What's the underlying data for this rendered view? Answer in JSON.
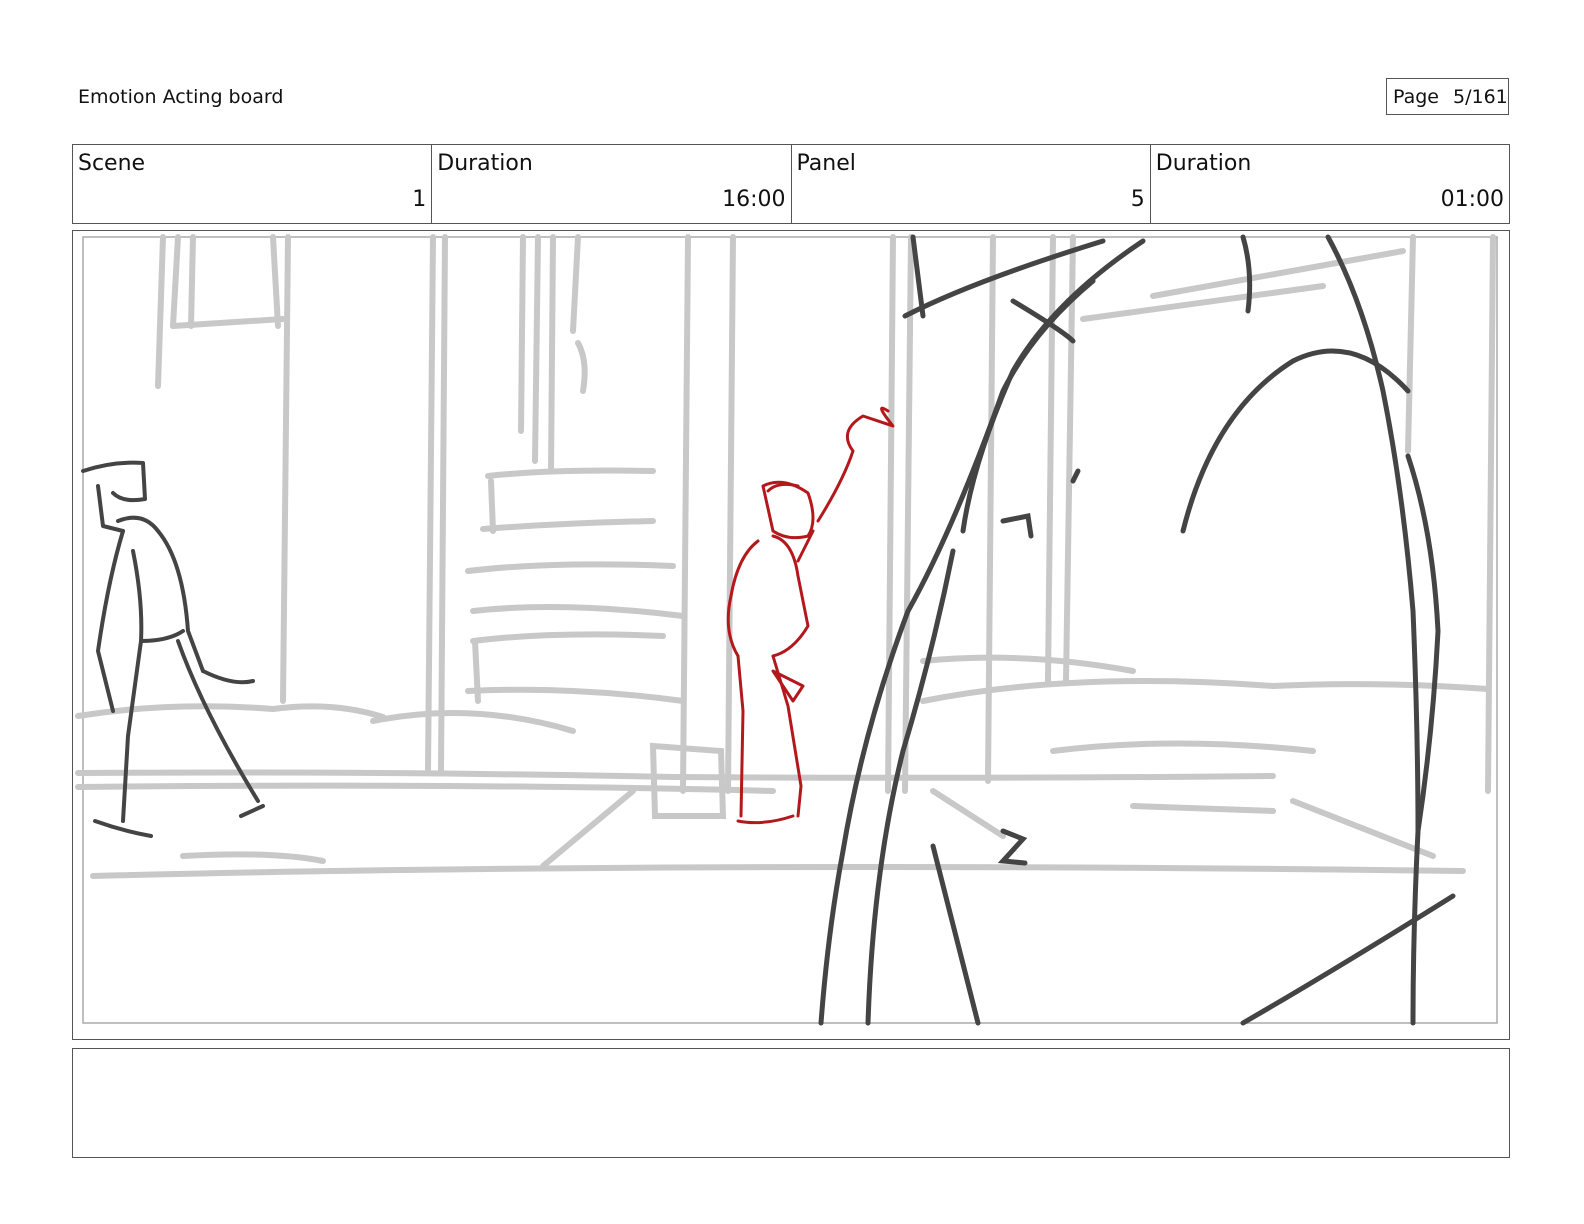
{
  "header": {
    "board_title": "Emotion Acting board",
    "page_label": "Page",
    "page_value": "5/161"
  },
  "info": {
    "scene_label": "Scene",
    "scene_value": "1",
    "scene_duration_label": "Duration",
    "scene_duration_value": "16:00",
    "panel_label": "Panel",
    "panel_value": "5",
    "panel_duration_label": "Duration",
    "panel_duration_value": "01:00"
  },
  "notes": {
    "text": ""
  },
  "colors": {
    "background_sketch": "#c8c8c8",
    "foreground_sketch": "#444444",
    "character_highlight": "#b3191c",
    "border": "#555555"
  }
}
